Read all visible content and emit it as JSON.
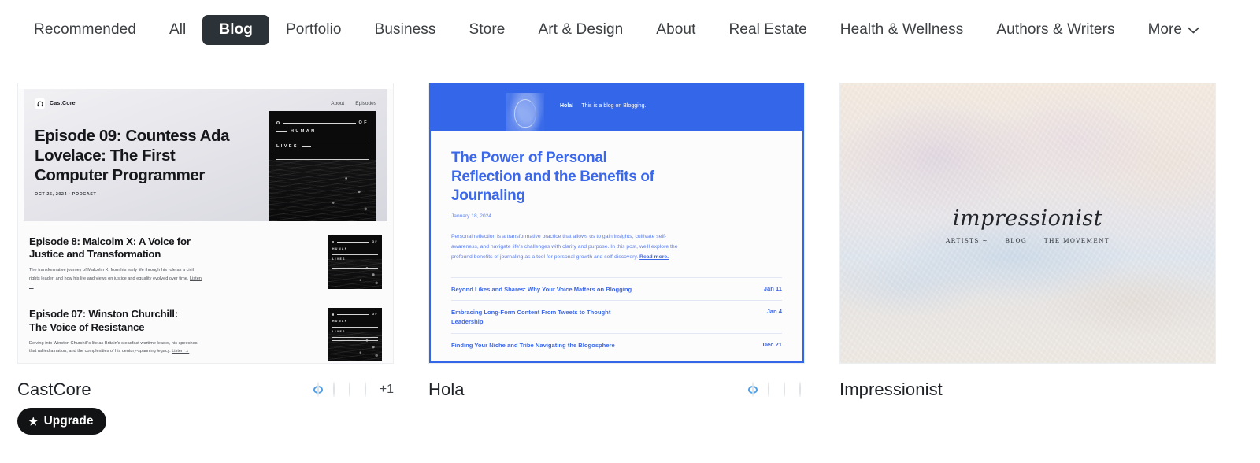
{
  "nav": {
    "items": [
      {
        "label": "Recommended",
        "active": false
      },
      {
        "label": "All",
        "active": false
      },
      {
        "label": "Blog",
        "active": true
      },
      {
        "label": "Portfolio",
        "active": false
      },
      {
        "label": "Business",
        "active": false
      },
      {
        "label": "Store",
        "active": false
      },
      {
        "label": "Art & Design",
        "active": false
      },
      {
        "label": "About",
        "active": false
      },
      {
        "label": "Real Estate",
        "active": false
      },
      {
        "label": "Health & Wellness",
        "active": false
      },
      {
        "label": "Authors & Writers",
        "active": false
      }
    ],
    "more_label": "More",
    "more_icon": "chevron-down-icon",
    "active_bg": "#2c3338"
  },
  "cards": [
    {
      "name": "CastCore",
      "upgrade_label": "Upgrade",
      "upgrade_icon": "star-icon",
      "swatch_overflow": "+1",
      "swatches": [
        {
          "left": "#ffffff",
          "right": "#1d1f21",
          "selected": true
        },
        {
          "left": "#f2f5ec",
          "right": "#7d9455",
          "selected": false
        },
        {
          "left": "#ffffff",
          "right": "#7b1438",
          "selected": false
        },
        {
          "left": "#f6f2fb",
          "right": "#6c1fe0",
          "selected": false
        }
      ],
      "preview": {
        "brand": "CastCore",
        "brand_icon": "headphones-icon",
        "nav": [
          "About",
          "Episodes"
        ],
        "hero_title": "Episode 09: Countess Ada Lovelace: The First Computer Programmer",
        "hero_meta": "OCT 25, 2024  ·  PODCAST",
        "art_text_1": "OF",
        "art_text_2": "HUMAN",
        "art_text_3": "LIVES",
        "episodes": [
          {
            "title": "Episode 8: Malcolm X: A Voice for Justice and Transformation",
            "desc": "The transformative journey of Malcolm X, from his early life through his role as a civil rights leader, and how his life and views on justice and equality evolved over time.",
            "link": "Listen →"
          },
          {
            "title": "Episode 07: Winston Churchill: The Voice of Resistance",
            "desc": "Delving into Winston Churchill's life as Britain's steadfast wartime leader, his speeches that rallied a nation, and the complexities of his century-spanning legacy.",
            "link": "Listen →"
          }
        ]
      }
    },
    {
      "name": "Hola",
      "swatches": [
        {
          "left": "#f4f6ff",
          "right": "#2f5ce0",
          "selected": true
        },
        {
          "left": "#f3f6f1",
          "right": "#1c3b2a",
          "selected": false
        },
        {
          "left": "#fdf6f1",
          "right": "#a04a2c",
          "selected": false
        },
        {
          "left": "#fdf1f4",
          "right": "#e9c3ce",
          "selected": false
        }
      ],
      "preview": {
        "tagline_bold": "Hola!",
        "tagline": "This is a blog on Blogging.",
        "accent": "#3366e8",
        "avatar_icon": "portrait-silhouette",
        "post_title": "The Power of Personal Reflection and the Benefits of Journaling",
        "post_date": "January 18, 2024",
        "post_body": "Personal reflection is a transformative practice that allows us to gain insights, cultivate self-awareness, and navigate life's challenges with clarity and purpose. In this post, we'll explore the profound benefits of journaling as a tool for personal growth and self-discovery.",
        "read_more": "Read more.",
        "posts": [
          {
            "title": "Beyond Likes and Shares: Why Your Voice Matters on Blogging",
            "date": "Jan 11"
          },
          {
            "title": "Embracing Long-Form Content From Tweets to Thought Leadership",
            "date": "Jan 4"
          },
          {
            "title": "Finding Your Niche and Tribe Navigating the Blogosphere",
            "date": "Dec 21"
          }
        ]
      }
    },
    {
      "name": "Impressionist",
      "preview": {
        "wordmark": "impressionist",
        "nav": [
          "ARTISTS ~",
          "BLOG",
          "THE MOVEMENT"
        ]
      }
    }
  ]
}
